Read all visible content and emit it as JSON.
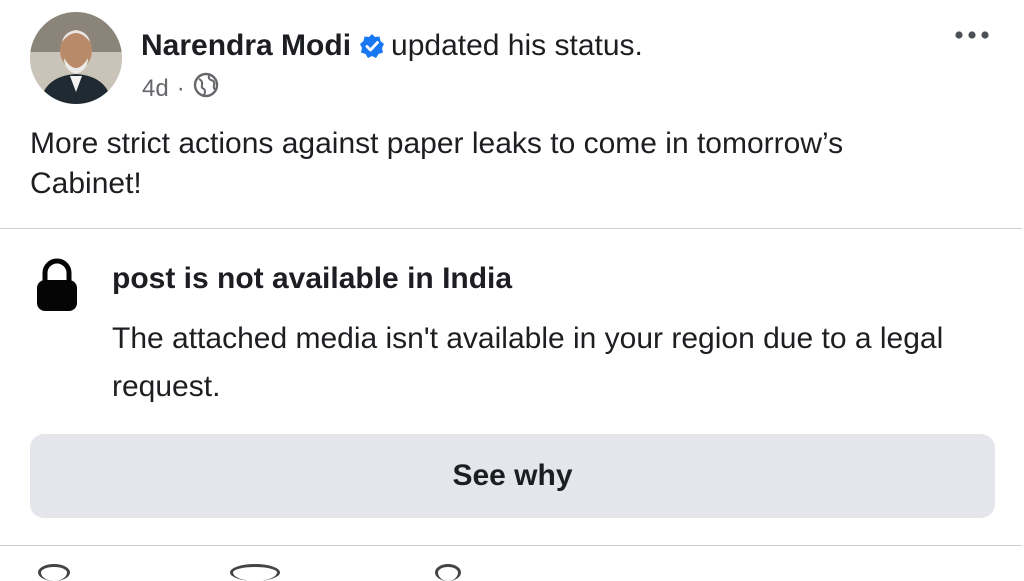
{
  "post": {
    "author_name": "Narendra Modi",
    "action_text": "updated his status.",
    "time": "4d",
    "separator": "·",
    "text": "More strict actions against paper leaks to come in tomorrow’s Cabinet!"
  },
  "icons": {
    "verified": "verified-badge-icon",
    "audience": "globe-icon",
    "more": "more-options-icon",
    "lock": "lock-icon"
  },
  "notice": {
    "title": "post is not available in India",
    "body": "The attached media isn't available in your region due to a legal request.",
    "button_label": "See why"
  },
  "colors": {
    "verified_blue": "#1877f2",
    "button_bg": "#e4e6eb",
    "secondary_text": "#65676b"
  }
}
